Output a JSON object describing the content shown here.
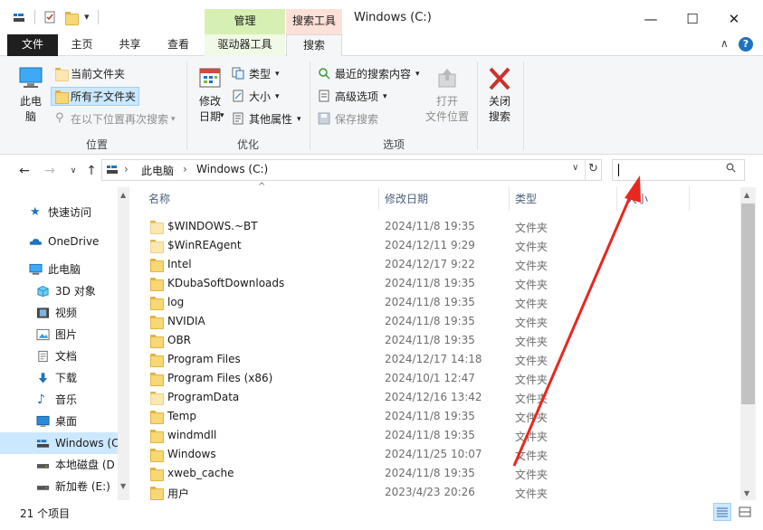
{
  "window": {
    "title": "Windows (C:)",
    "minimize_glyph": "—",
    "maximize_glyph": "☐",
    "close_glyph": "✕"
  },
  "quick_access": {
    "dropdown_glyph": "▾"
  },
  "context_tabs": {
    "manage": "管理",
    "search_tools": "搜索工具"
  },
  "tabs": {
    "file": "文件",
    "home": "主页",
    "share": "共享",
    "view": "查看",
    "drive_tools": "驱动器工具",
    "search": "搜索",
    "collapse_glyph": "∧",
    "help_glyph": "?"
  },
  "ribbon": {
    "location": {
      "this_pc_line1": "此电",
      "this_pc_line2": "脑",
      "current_folder": "当前文件夹",
      "all_subfolders": "所有子文件夹",
      "search_again": "在以下位置再次搜索",
      "group_label": "位置"
    },
    "refine": {
      "date_modified_line1": "修改",
      "date_modified_line2": "日期",
      "type": "类型",
      "size": "大小",
      "other_props": "其他属性",
      "group_label": "优化"
    },
    "options": {
      "recent_searches": "最近的搜索内容",
      "advanced_options": "高级选项",
      "save_search": "保存搜索",
      "open_location_line1": "打开",
      "open_location_line2": "文件位置",
      "close_search_line1": "关闭",
      "close_search_line2": "搜索",
      "group_label": "选项"
    }
  },
  "address": {
    "back": "←",
    "forward": "→",
    "dropdown": "∨",
    "up": "↑",
    "crumb_sep": "›",
    "crumbs": [
      "此电脑",
      "Windows (C:)"
    ],
    "dropdown_arrow": "∨",
    "refresh": "↻",
    "search_value": "",
    "search_glyph": "⚲"
  },
  "nav": {
    "items": [
      {
        "label": "快速访问"
      },
      {
        "label": "OneDrive"
      },
      {
        "label": "此电脑"
      },
      {
        "label": "3D 对象"
      },
      {
        "label": "视频"
      },
      {
        "label": "图片"
      },
      {
        "label": "文档"
      },
      {
        "label": "下载"
      },
      {
        "label": "音乐"
      },
      {
        "label": "桌面"
      },
      {
        "label": "Windows (C"
      },
      {
        "label": "本地磁盘 (D"
      },
      {
        "label": "新加卷 (E:)"
      }
    ]
  },
  "columns": {
    "name": "名称",
    "date": "修改日期",
    "type": "类型",
    "size": "大小",
    "sort_glyph": "^"
  },
  "files": [
    {
      "name": "$WINDOWS.~BT",
      "date": "2024/11/8 19:35",
      "type": "文件夹"
    },
    {
      "name": "$WinREAgent",
      "date": "2024/12/11 9:29",
      "type": "文件夹"
    },
    {
      "name": "Intel",
      "date": "2024/12/17 9:22",
      "type": "文件夹"
    },
    {
      "name": "KDubaSoftDownloads",
      "date": "2024/11/8 19:35",
      "type": "文件夹"
    },
    {
      "name": "log",
      "date": "2024/11/8 19:35",
      "type": "文件夹"
    },
    {
      "name": "NVIDIA",
      "date": "2024/11/8 19:35",
      "type": "文件夹"
    },
    {
      "name": "OBR",
      "date": "2024/11/8 19:35",
      "type": "文件夹"
    },
    {
      "name": "Program Files",
      "date": "2024/12/17 14:18",
      "type": "文件夹"
    },
    {
      "name": "Program Files (x86)",
      "date": "2024/10/1 12:47",
      "type": "文件夹"
    },
    {
      "name": "ProgramData",
      "date": "2024/12/16 13:42",
      "type": "文件夹"
    },
    {
      "name": "Temp",
      "date": "2024/11/8 19:35",
      "type": "文件夹"
    },
    {
      "name": "windmdll",
      "date": "2024/11/8 19:35",
      "type": "文件夹"
    },
    {
      "name": "Windows",
      "date": "2024/11/25 10:07",
      "type": "文件夹"
    },
    {
      "name": "xweb_cache",
      "date": "2024/11/8 19:35",
      "type": "文件夹"
    },
    {
      "name": "用户",
      "date": "2023/4/23 20:26",
      "type": "文件夹"
    }
  ],
  "status": {
    "count": "21 个项目"
  },
  "colors": {
    "accent": "#0063b1",
    "annotation_arrow": "#e8271f",
    "context_manage": "#d6f0b4",
    "context_search": "#fde0d7"
  }
}
